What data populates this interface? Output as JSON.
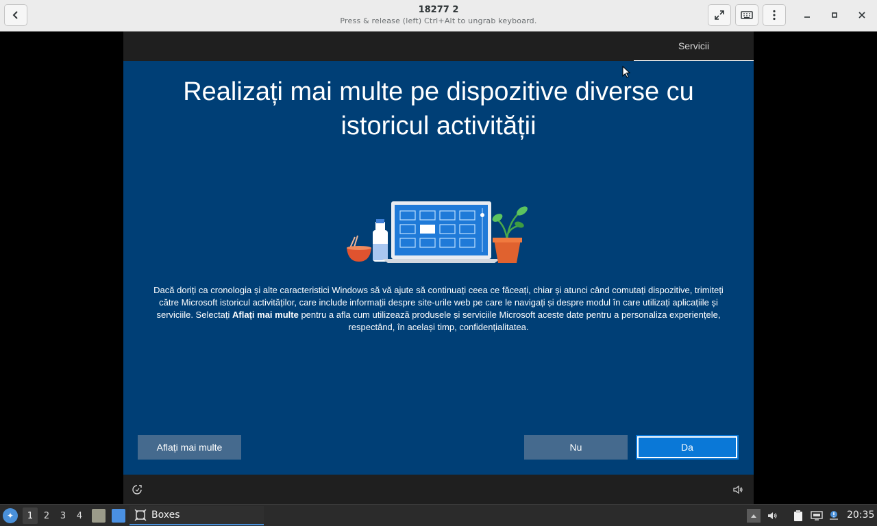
{
  "headerbar": {
    "title": "18277 2",
    "subtitle": "Press & release (left) Ctrl+Alt to ungrab keyboard.",
    "icons": {
      "back": "back-arrow-icon",
      "fullscreen": "fullscreen-icon",
      "keyboard": "keyboard-icon",
      "menu": "kebab-menu-icon",
      "minimize": "minimize-icon",
      "maximize": "maximize-icon",
      "close": "close-icon"
    }
  },
  "vm": {
    "top_tab": "Servicii",
    "title": "Realizați mai multe pe dispozitive diverse cu istoricul activității",
    "body_part1": "Dacă doriți ca cronologia și alte caracteristici Windows să vă ajute să continuați ceea ce făceați, chiar și atunci când comutați dispozitive, trimiteți către Microsoft istoricul activităților, care include informații despre site-urile web pe care le navigați și despre modul în care utilizați aplicațiile și serviciile. Selectați ",
    "body_bold": "Aflați mai multe",
    "body_part2": " pentru a afla cum utilizează produsele și serviciile Microsoft aceste date pentru a personaliza experiențele, respectând, în același timp, confidențialitatea.",
    "buttons": {
      "learn_more": "Aflați mai multe",
      "no": "Nu",
      "yes": "Da"
    },
    "bottom_icons": {
      "ease": "ease-of-access-icon",
      "volume": "volume-icon"
    }
  },
  "taskbar": {
    "workspaces": [
      "1",
      "2",
      "3",
      "4"
    ],
    "active_workspace": "1",
    "task_label": "Boxes",
    "clock": "20:35"
  },
  "colors": {
    "oobe_bg": "#003f76",
    "primary_button": "#0a78d7",
    "secondary_button": "#456a8e",
    "headerbar": "#ececec"
  }
}
